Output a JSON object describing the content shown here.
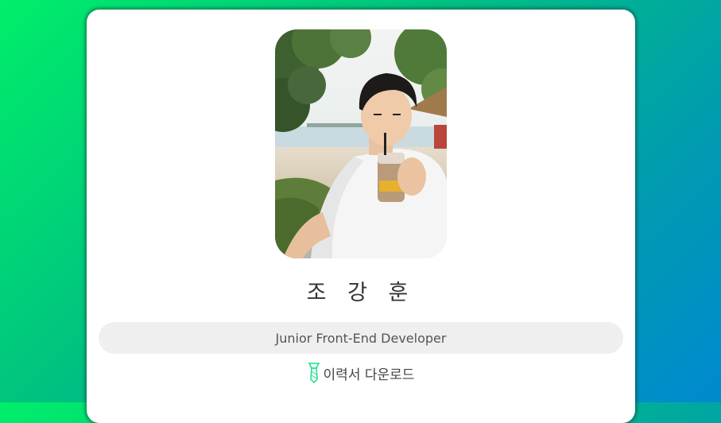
{
  "profile": {
    "photo_icon": "profile-photo",
    "name": "조 강 훈",
    "role": "Junior Front-End Developer",
    "resume_icon": "tie-icon",
    "resume_label": "이력서 다운로드"
  },
  "colors": {
    "gradient_start": "#00ee6a",
    "gradient_end": "#0089d0",
    "card": "#ffffff",
    "pill": "#efefef",
    "tie_accent": "#16e08a"
  }
}
